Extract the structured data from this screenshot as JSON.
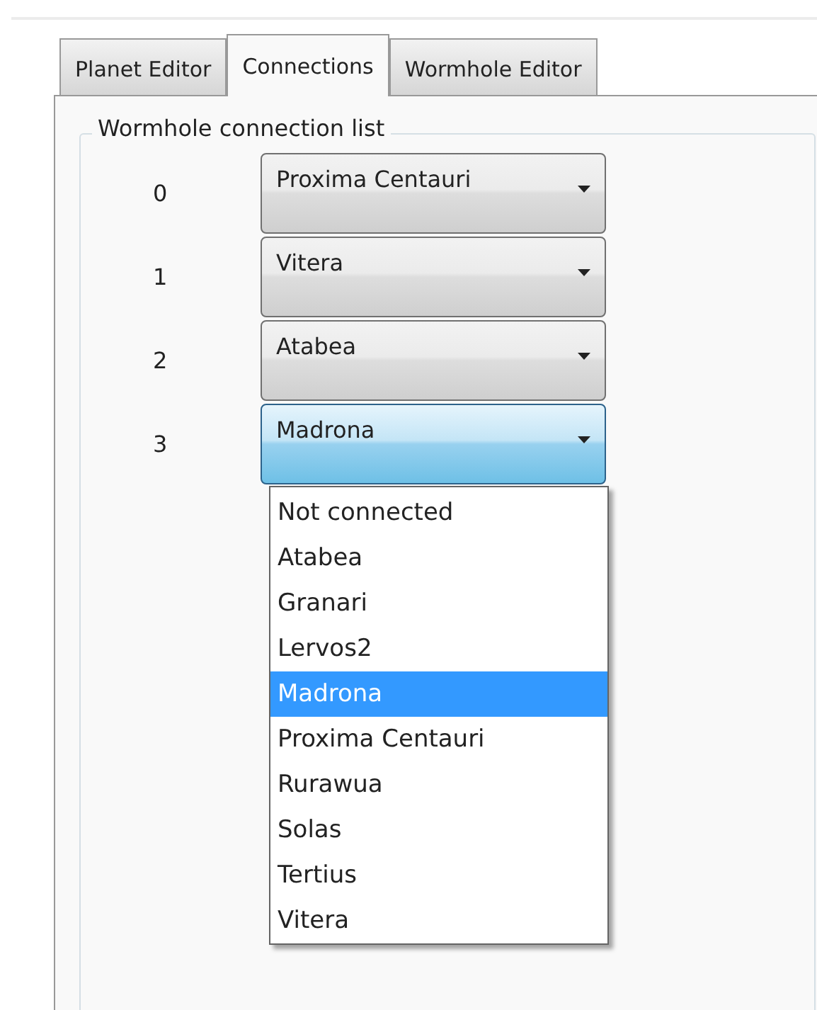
{
  "tabs": [
    {
      "label": "Planet Editor",
      "selected": false
    },
    {
      "label": "Connections",
      "selected": true
    },
    {
      "label": "Wormhole Editor",
      "selected": false
    }
  ],
  "group": {
    "title": "Wormhole connection list"
  },
  "connections": [
    {
      "index": "0",
      "value": "Proxima Centauri",
      "open": false
    },
    {
      "index": "1",
      "value": "Vitera",
      "open": false
    },
    {
      "index": "2",
      "value": "Atabea",
      "open": false
    },
    {
      "index": "3",
      "value": "Madrona",
      "open": true
    }
  ],
  "dropdown": {
    "items": [
      {
        "label": "Not connected",
        "selected": false
      },
      {
        "label": "Atabea",
        "selected": false
      },
      {
        "label": "Granari",
        "selected": false
      },
      {
        "label": "Lervos2",
        "selected": false
      },
      {
        "label": "Madrona",
        "selected": true
      },
      {
        "label": "Proxima Centauri",
        "selected": false
      },
      {
        "label": "Rurawua",
        "selected": false
      },
      {
        "label": "Solas",
        "selected": false
      },
      {
        "label": "Tertius",
        "selected": false
      },
      {
        "label": "Vitera",
        "selected": false
      }
    ]
  }
}
